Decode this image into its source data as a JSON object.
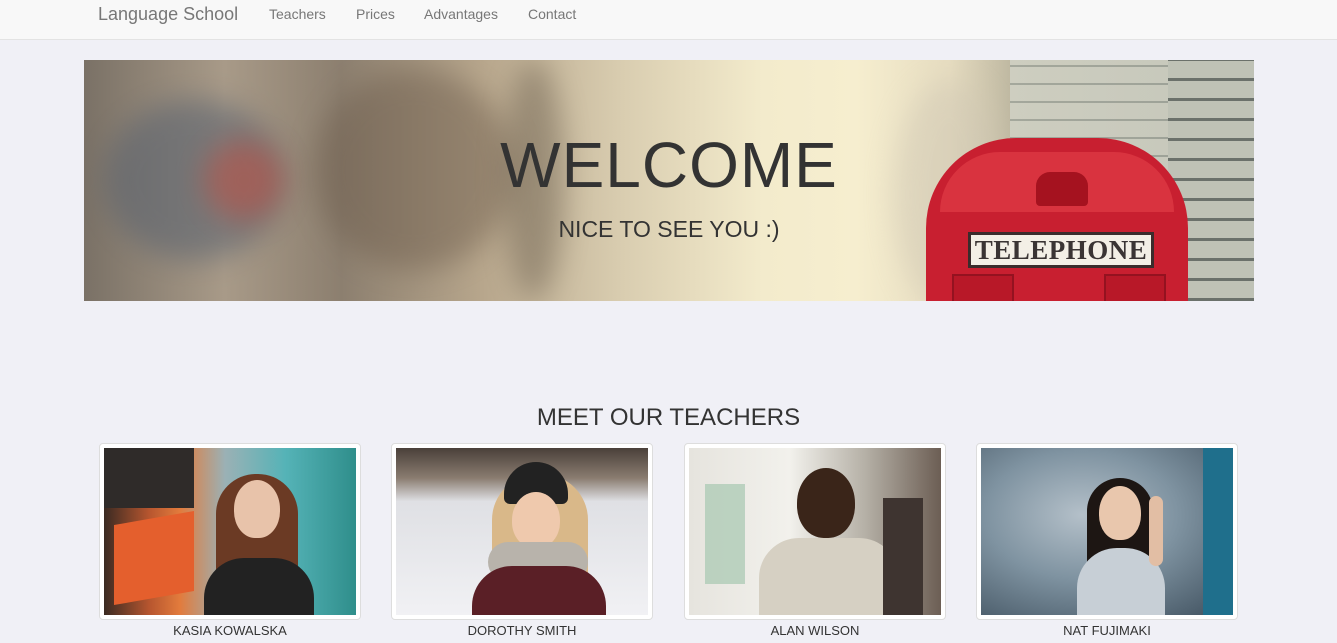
{
  "navbar": {
    "brand": "Language School",
    "links": [
      "Teachers",
      "Prices",
      "Advantages",
      "Contact"
    ]
  },
  "hero": {
    "title": "WELCOME",
    "subtitle": "NICE TO SEE YOU :)",
    "sign_text": "TELEPHONE"
  },
  "teachers_section": {
    "title": "MEET OUR TEACHERS",
    "teachers": [
      {
        "name": "KASIA KOWALSKA"
      },
      {
        "name": "DOROTHY SMITH"
      },
      {
        "name": "ALAN WILSON"
      },
      {
        "name": "NAT FUJIMAKI"
      }
    ]
  },
  "colors": {
    "background": "#f0f0f6",
    "navbar_bg": "#f8f8f8",
    "nav_text": "#777777",
    "booth_red": "#c81f30"
  }
}
